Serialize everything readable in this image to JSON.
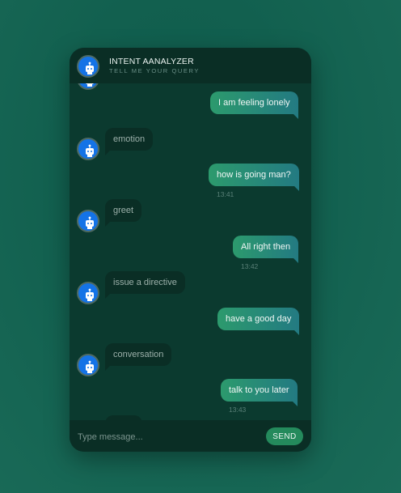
{
  "header": {
    "title": "INTENT AANALYZER",
    "subtitle": "TELL ME YOUR QUERY",
    "avatar_icon": "robot-icon"
  },
  "messages": [
    {
      "sender": "user",
      "text": "I am feeling lonely",
      "time": ""
    },
    {
      "sender": "bot",
      "text": "emotion"
    },
    {
      "sender": "user",
      "text": "how is going man?",
      "time": "13:41"
    },
    {
      "sender": "bot",
      "text": "greet"
    },
    {
      "sender": "user",
      "text": "All right then",
      "time": "13:42"
    },
    {
      "sender": "bot",
      "text": "issue a directive"
    },
    {
      "sender": "user",
      "text": "have a good day",
      "time": ""
    },
    {
      "sender": "bot",
      "text": "conversation"
    },
    {
      "sender": "user",
      "text": "talk to you later",
      "time": "13:43"
    }
  ],
  "composer": {
    "placeholder": "Type message...",
    "send_label": "SEND"
  },
  "colors": {
    "background": "#12604f",
    "panel": "#0b3a2f",
    "header": "#0a2e25",
    "user_bubble": "#2c9a6d",
    "send_button": "#248a5c",
    "avatar": "#1473e6"
  }
}
